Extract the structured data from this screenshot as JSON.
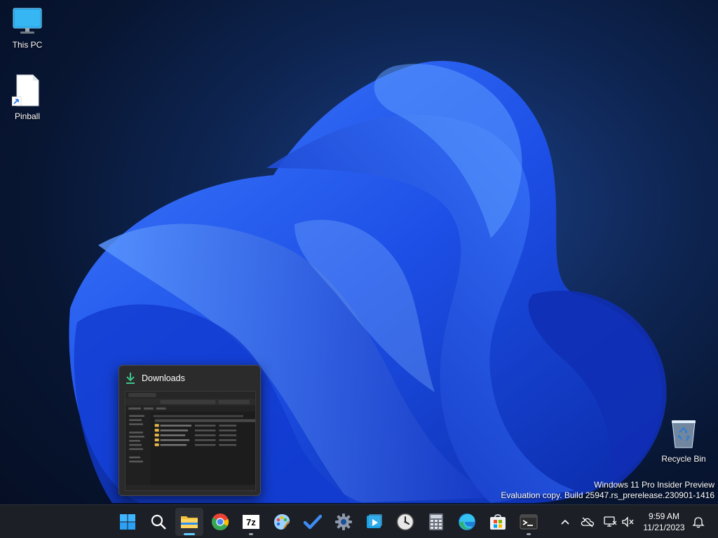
{
  "desktop": {
    "icons": [
      {
        "label": "This PC"
      },
      {
        "label": "Pinball"
      },
      {
        "label": "Recycle Bin"
      }
    ]
  },
  "watermark": {
    "line1": "Windows 11 Pro Insider Preview",
    "line2": "Evaluation copy. Build 25947.rs_prerelease.230901-1416"
  },
  "preview": {
    "title": "Downloads",
    "icon": "download-icon"
  },
  "taskbar": {
    "apps": [
      {
        "name": "start-button",
        "icon": "windows-logo-icon"
      },
      {
        "name": "search-button",
        "icon": "search-icon"
      },
      {
        "name": "file-explorer",
        "icon": "folder-icon"
      },
      {
        "name": "chrome",
        "icon": "chrome-icon"
      },
      {
        "name": "7-zip",
        "icon": "7zip-icon",
        "label": "7z"
      },
      {
        "name": "paint",
        "icon": "palette-icon"
      },
      {
        "name": "todo",
        "icon": "checkmark-icon"
      },
      {
        "name": "settings",
        "icon": "gear-icon"
      },
      {
        "name": "media-player",
        "icon": "play-icon"
      },
      {
        "name": "clock-app",
        "icon": "clock-icon"
      },
      {
        "name": "calculator",
        "icon": "calculator-icon"
      },
      {
        "name": "edge",
        "icon": "edge-icon"
      },
      {
        "name": "store",
        "icon": "store-icon"
      },
      {
        "name": "terminal",
        "icon": "terminal-icon"
      }
    ],
    "tray": {
      "time": "9:59 AM",
      "date": "11/21/2023"
    }
  },
  "colors": {
    "accent": "#60cdff",
    "taskbar_bg": "#1c1f26",
    "wallpaper_blue": "#1a4fe0"
  }
}
